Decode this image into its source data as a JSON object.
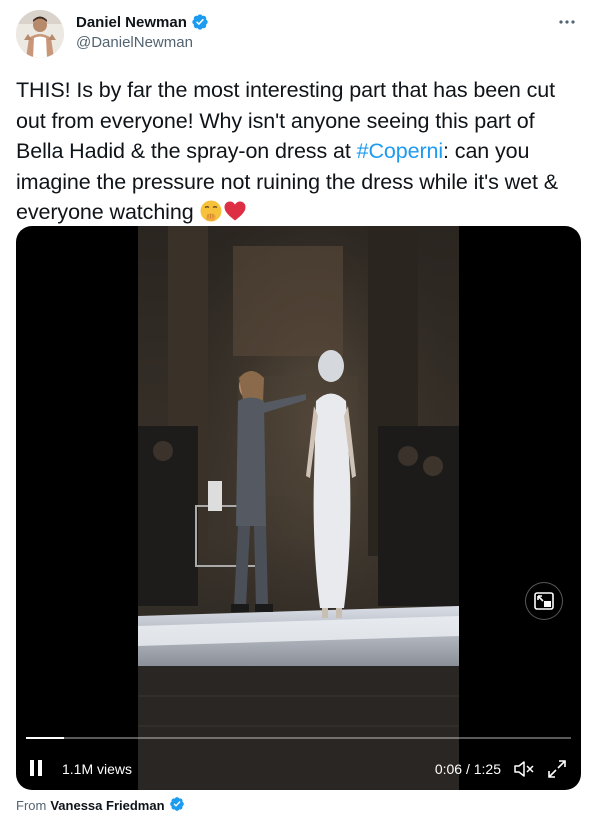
{
  "author": {
    "display_name": "Daniel Newman",
    "handle": "@DanielNewman",
    "verified": true
  },
  "tweet": {
    "text_before": "THIS! Is by far the most interesting part that has been cut out from everyone! Why isn't anyone seeing this part of Bella Hadid & the spray-on dress at ",
    "hashtag": "#Coperni",
    "text_after": ": can you imagine the pressure not ruining the dress while it's wet & everyone watching "
  },
  "video": {
    "views": "1.1M views",
    "time": "0:06 / 1:25",
    "progress_fraction": 0.07
  },
  "source": {
    "prefix": "From",
    "name": "Vanessa Friedman"
  },
  "colors": {
    "link": "#1d9bf0",
    "verified": "#1d9bf0",
    "secondary_text": "#536471"
  }
}
